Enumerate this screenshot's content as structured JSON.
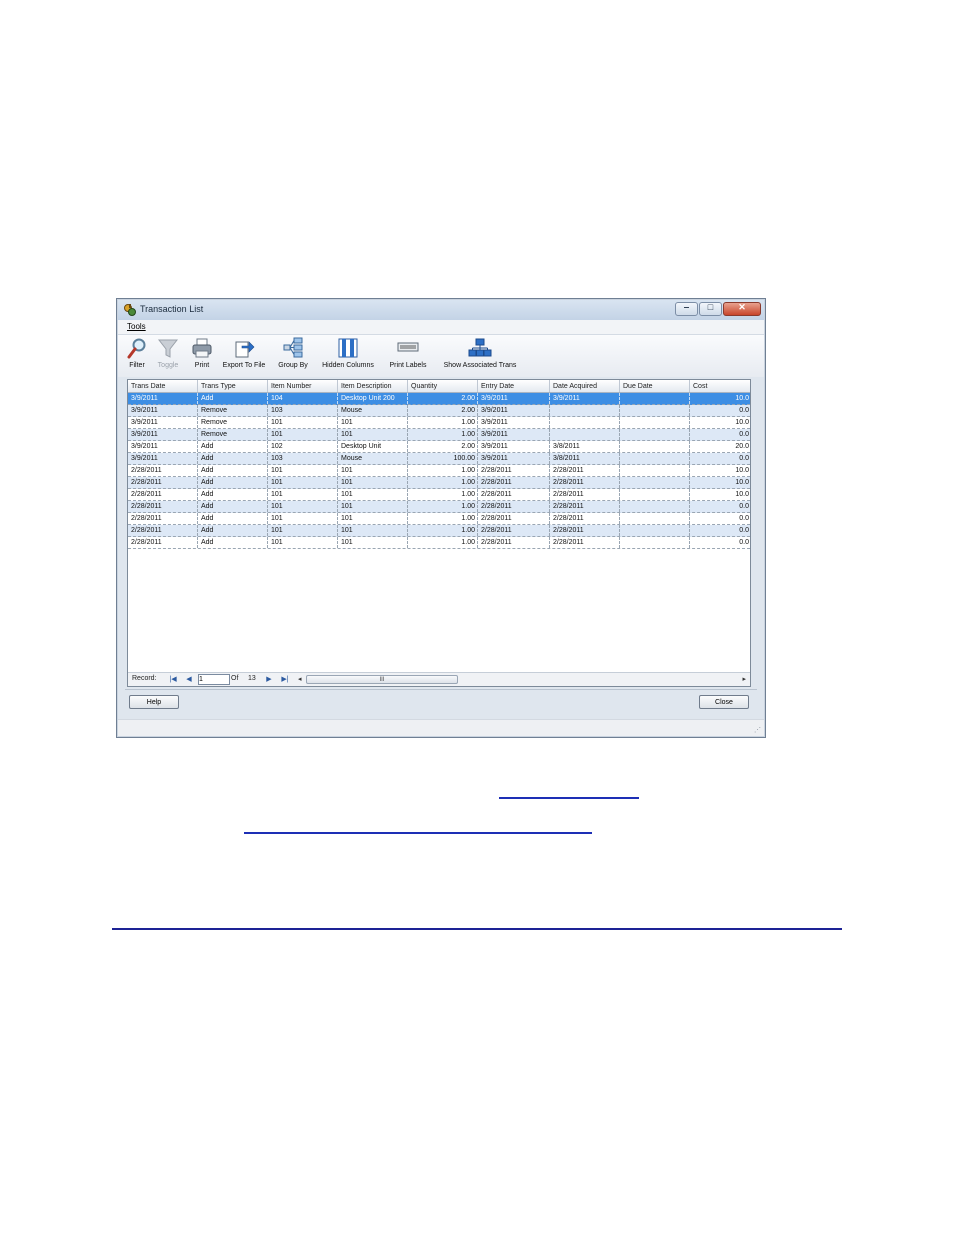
{
  "window": {
    "title": "Transaction List",
    "menu": [
      "Tools"
    ],
    "controls": {
      "minimize": "‒",
      "maximize": "□",
      "close": "✕"
    }
  },
  "toolbar": {
    "items": [
      {
        "label": "Filter",
        "icon": "magnifier-icon",
        "enabled": true
      },
      {
        "label": "Toggle",
        "icon": "funnel-icon",
        "enabled": false
      },
      {
        "label": "Print",
        "icon": "printer-icon",
        "enabled": true
      },
      {
        "label": "Export To File",
        "icon": "export-icon",
        "enabled": true
      },
      {
        "label": "Group By",
        "icon": "group-by-icon",
        "enabled": true
      },
      {
        "label": "Hidden Columns",
        "icon": "columns-icon",
        "enabled": true
      },
      {
        "label": "Print Labels",
        "icon": "labels-icon",
        "enabled": true
      },
      {
        "label": "Show Associated Trans",
        "icon": "hierarchy-icon",
        "enabled": true
      }
    ]
  },
  "grid": {
    "columns": [
      "Trans Date",
      "Trans Type",
      "Item Number",
      "Item Description",
      "Quantity",
      "Entry Date",
      "Date Acquired",
      "Due Date",
      "Cost"
    ],
    "rows": [
      [
        "3/9/2011",
        "Add",
        "104",
        "Desktop Unit 200",
        "2.00",
        "3/9/2011",
        "3/9/2011",
        "",
        "10.0"
      ],
      [
        "3/9/2011",
        "Remove",
        "103",
        "Mouse",
        "2.00",
        "3/9/2011",
        "",
        "",
        "0.0"
      ],
      [
        "3/9/2011",
        "Remove",
        "101",
        "101",
        "1.00",
        "3/9/2011",
        "",
        "",
        "10.0"
      ],
      [
        "3/9/2011",
        "Remove",
        "101",
        "101",
        "1.00",
        "3/9/2011",
        "",
        "",
        "0.0"
      ],
      [
        "3/9/2011",
        "Add",
        "102",
        "Desktop Unit",
        "2.00",
        "3/9/2011",
        "3/8/2011",
        "",
        "20.0"
      ],
      [
        "3/9/2011",
        "Add",
        "103",
        "Mouse",
        "100.00",
        "3/9/2011",
        "3/8/2011",
        "",
        "0.0"
      ],
      [
        "2/28/2011",
        "Add",
        "101",
        "101",
        "1.00",
        "2/28/2011",
        "2/28/2011",
        "",
        "10.0"
      ],
      [
        "2/28/2011",
        "Add",
        "101",
        "101",
        "1.00",
        "2/28/2011",
        "2/28/2011",
        "",
        "10.0"
      ],
      [
        "2/28/2011",
        "Add",
        "101",
        "101",
        "1.00",
        "2/28/2011",
        "2/28/2011",
        "",
        "10.0"
      ],
      [
        "2/28/2011",
        "Add",
        "101",
        "101",
        "1.00",
        "2/28/2011",
        "2/28/2011",
        "",
        "0.0"
      ],
      [
        "2/28/2011",
        "Add",
        "101",
        "101",
        "1.00",
        "2/28/2011",
        "2/28/2011",
        "",
        "0.0"
      ],
      [
        "2/28/2011",
        "Add",
        "101",
        "101",
        "1.00",
        "2/28/2011",
        "2/28/2011",
        "",
        "0.0"
      ],
      [
        "2/28/2011",
        "Add",
        "101",
        "101",
        "1.00",
        "2/28/2011",
        "2/28/2011",
        "",
        "0.0"
      ]
    ],
    "selected_row": 0
  },
  "navigator": {
    "record_label": "Record:",
    "current": "1",
    "of_label": "Of",
    "total": "13",
    "scroll_grip": "III"
  },
  "buttons": {
    "help": "Help",
    "close": "Close"
  },
  "colors": {
    "selection": "#3d8ee4",
    "alt_row": "#dde8f6",
    "link": "#1d2fb5"
  }
}
